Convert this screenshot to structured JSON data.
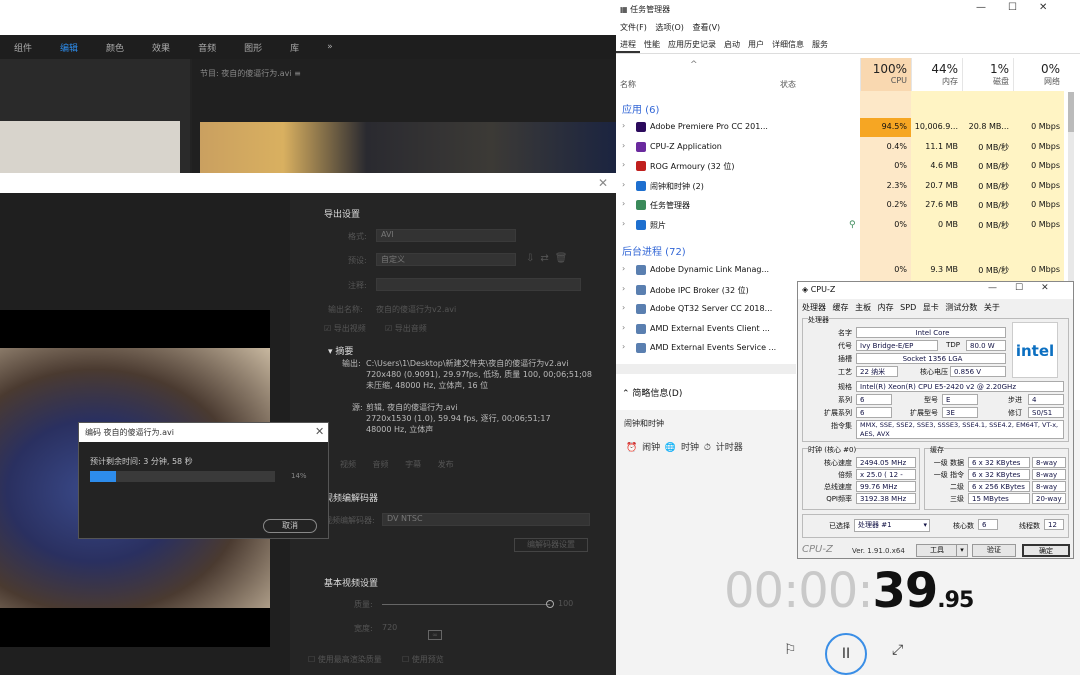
{
  "premiere": {
    "menu": [
      "组件",
      "编辑",
      "颜色",
      "效果",
      "音频",
      "图形",
      "库",
      "»"
    ],
    "program_title": "节目: 夜自的傻逼行为.avi ≡",
    "export_settings": {
      "title": "导出设置",
      "format_label": "格式:",
      "format_value": "AVI",
      "preset_label": "预设:",
      "preset_value": "自定义",
      "comment_label": "注释:",
      "output_name_label": "输出名称:",
      "output_name_value": "夜自的傻逼行为v2.avi",
      "export_video": "导出视频",
      "export_audio": "导出音频",
      "summary_title": "摘要",
      "output_label": "输出:",
      "output_lines": [
        "C:\\Users\\1\\Desktop\\新建文件夹\\夜自的傻逼行为v2.avi",
        "720x480 (0.9091), 29.97fps, 低场, 质量 100, 00;06;51;08",
        "未压缩, 48000 Hz, 立体声, 16 位"
      ],
      "source_label": "源:",
      "source_lines": [
        "剪辑, 夜自的傻逼行为.avi",
        "2720x1530 (1.0), 59.94 fps, 逐行, 00;06;51;17",
        "48000 Hz, 立体声"
      ],
      "tabs": [
        "视频",
        "音频",
        "字幕",
        "发布"
      ],
      "codec_title": "视频编解码器",
      "codec_label": "视频编解码器:",
      "codec_value": "DV NTSC",
      "codec_settings_btn": "编解码器设置",
      "basic_title": "基本视频设置",
      "quality_label": "质量:",
      "quality_value": "100",
      "width_label": "宽度:",
      "width_value": "720",
      "max_render": "使用最高渲染质量",
      "use_preview": "使用预览"
    },
    "encode_dialog": {
      "title": "编码 夜自的傻逼行为.avi",
      "remaining": "预计剩余时间: 3 分钟, 58 秒",
      "progress": 0.14,
      "percent_text": "14%",
      "cancel": "取消"
    }
  },
  "taskmgr": {
    "title": "任务管理器",
    "menu": "文件(F) 选项(O) 查看(V)",
    "tabs": [
      "进程",
      "性能",
      "应用历史记录",
      "启动",
      "用户",
      "详细信息",
      "服务"
    ],
    "col_name": "名称",
    "col_status": "状态",
    "cpu_pct": "100%",
    "cpu_label": "CPU",
    "mem_pct": "44%",
    "mem_label": "内存",
    "disk_pct": "1%",
    "disk_label": "磁盘",
    "net_pct": "0%",
    "net_label": "网络",
    "apps_header": "应用 (6)",
    "bg_header": "后台进程 (72)",
    "apps": [
      {
        "name": "Adobe Premiere Pro CC 201...",
        "cpu": "94.5%",
        "mem": "10,006.9...",
        "disk": "20.8 MB...",
        "net": "0 Mbps",
        "icon": "#2b0a5c"
      },
      {
        "name": "CPU-Z Application",
        "cpu": "0.4%",
        "mem": "11.1 MB",
        "disk": "0 MB/秒",
        "net": "0 Mbps",
        "icon": "#6a2a9e"
      },
      {
        "name": "ROG Armoury (32 位)",
        "cpu": "0%",
        "mem": "4.6 MB",
        "disk": "0 MB/秒",
        "net": "0 Mbps",
        "icon": "#c0201e"
      },
      {
        "name": "闹钟和时钟 (2)",
        "cpu": "2.3%",
        "mem": "20.7 MB",
        "disk": "0 MB/秒",
        "net": "0 Mbps",
        "icon": "#1e6fcf"
      },
      {
        "name": "任务管理器",
        "cpu": "0.2%",
        "mem": "27.6 MB",
        "disk": "0 MB/秒",
        "net": "0 Mbps",
        "icon": "#3a8a5a"
      },
      {
        "name": "照片",
        "cpu": "0%",
        "mem": "0 MB",
        "disk": "0 MB/秒",
        "net": "0 Mbps",
        "icon": "#1e6fcf"
      }
    ],
    "bg": [
      {
        "name": "Adobe Dynamic Link Manag...",
        "cpu": "0%",
        "mem": "9.3 MB",
        "disk": "0 MB/秒",
        "net": "0 Mbps"
      },
      {
        "name": "Adobe IPC Broker (32 位)"
      },
      {
        "name": "Adobe QT32 Server CC 2018..."
      },
      {
        "name": "AMD External Events Client ..."
      },
      {
        "name": "AMD External Events Service ..."
      }
    ],
    "brief": "简略信息(D)",
    "colors": {
      "cpu_high": "#f6a623",
      "cpu_col": "#fde8c8",
      "mem_col": "#fff4c4"
    }
  },
  "clock": {
    "title": "闹钟和时钟",
    "tabs": "⏰ 闹钟    🌐 时钟    ⏱ 计时器",
    "time_dim": "00:00:",
    "time_main": "39",
    "time_frac": ".95",
    "flag_icon": "⚐",
    "pause_icon": "II",
    "expand_icon": "⤢"
  },
  "cpuz": {
    "title": "CPU-Z",
    "tabs": "处理器 缓存 主板 内存 SPD 显卡 测试分数 关于",
    "group_proc": "处理器",
    "name_l": "名字",
    "name_v": "Intel Core",
    "code_l": "代号",
    "code_v": "Ivy Bridge-E/EP",
    "tdp_l": "TDP",
    "tdp_v": "80.0 W",
    "socket_l": "插槽",
    "socket_v": "Socket 1356 LGA",
    "tech_l": "工艺",
    "tech_v": "22 纳米",
    "volt_l": "核心电压",
    "volt_v": "0.856 V",
    "spec_l": "规格",
    "spec_v": "Intel(R) Xeon(R) CPU E5-2420 v2 @ 2.20GHz",
    "family_l": "系列",
    "family_v": "6",
    "model_l": "型号",
    "model_v": "E",
    "step_l": "步进",
    "step_v": "4",
    "efam_l": "扩展系列",
    "efam_v": "6",
    "emod_l": "扩展型号",
    "emod_v": "3E",
    "rev_l": "修订",
    "rev_v": "S0/S1",
    "inst_l": "指令集",
    "inst_v": "MMX, SSE, SSE2, SSE3, SSSE3, SSE4.1, SSE4.2, EM64T, VT-x, AES, AVX",
    "clock_group": "时钟 (核心 #0)",
    "core_speed_l": "核心速度",
    "core_speed_v": "2494.05 MHz",
    "mult_l": "倍频",
    "mult_v": "x 25.0 ( 12 - 27)",
    "bus_l": "总线速度",
    "bus_v": "99.76 MHz",
    "qpi_l": "QPI频率",
    "qpi_v": "3192.38 MHz",
    "cache_group": "缓存",
    "l1d_l": "一级 数据",
    "l1d_v": "6 x 32 KBytes",
    "l1d_w": "8-way",
    "l1i_l": "一级 指令",
    "l1i_v": "6 x 32 KBytes",
    "l1i_w": "8-way",
    "l2_l": "二级",
    "l2_v": "6 x 256 KBytes",
    "l2_w": "8-way",
    "l3_l": "三级",
    "l3_v": "15 MBytes",
    "l3_w": "20-way",
    "sel_l": "已选择",
    "sel_v": "处理器 #1",
    "cores_l": "核心数",
    "cores_v": "6",
    "threads_l": "线程数",
    "threads_v": "12",
    "brand": "CPU-Z",
    "version": "Ver. 1.91.0.x64",
    "tools": "工具",
    "validate": "验证",
    "ok": "确定",
    "logo": "intel"
  }
}
